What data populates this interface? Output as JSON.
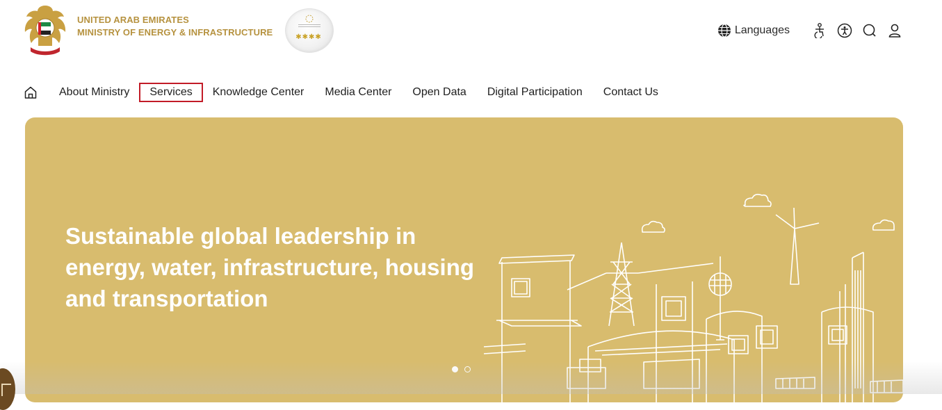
{
  "header": {
    "org_line1": "UNITED ARAB EMIRATES",
    "org_line2": "MINISTRY OF ENERGY & INFRASTRUCTURE",
    "languages_label": "Languages",
    "icons": [
      "emblem-icon",
      "award-badge-icon",
      "globe-icon",
      "accessibility-person-icon",
      "accessibility-icon",
      "search-icon",
      "user-icon"
    ]
  },
  "nav": {
    "items": [
      "About Ministry",
      "Services",
      "Knowledge Center",
      "Media Center",
      "Open Data",
      "Digital Participation",
      "Contact Us"
    ],
    "selected": "Services",
    "highlight_color": "#c21b27"
  },
  "hero": {
    "title_line1": "Sustainable global leadership in",
    "title_line2": "energy, water, infrastructure, housing",
    "title_line3": "and transportation",
    "background_color": "#d8bc6e",
    "slides_total": 2,
    "active_slide": 1
  },
  "colors": {
    "brand_gold": "#b6923f",
    "side_tab": "#6b4a22"
  }
}
